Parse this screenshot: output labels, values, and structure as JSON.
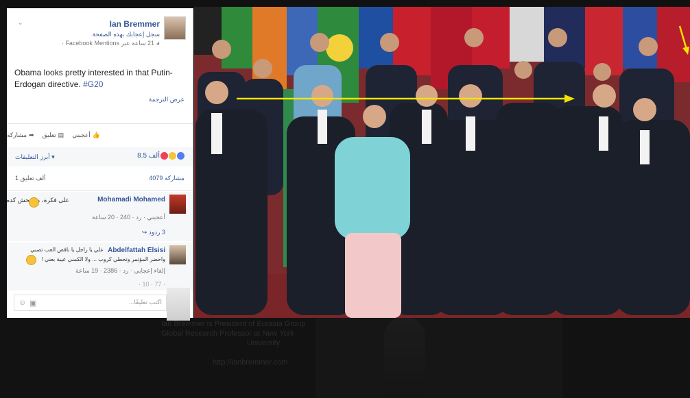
{
  "post_card": {
    "author": "Ian Bremmer",
    "subtitle_line1": "سجل إعجابك بهذه الصفحة",
    "subtitle_line2": "21 ساعة عبر Facebook Mentions · ",
    "text_main": "Obama looks pretty interested in that Putin-Erdogan directive. ",
    "hashtag": "#G20",
    "translate_link": "عرض الترجمة",
    "actions": {
      "like": "أعجبني",
      "comment": "تعليق",
      "share": "مشاركة"
    },
    "top_comments": "أبرز التعليقات ▾",
    "reactions_count": "8.5 ألف",
    "shares": "4079 مشاركة",
    "comments_count": "1 ألف تعليق",
    "comments": [
      {
        "name": "Mohamadi Mohamed",
        "text": "على فكرة، ميصحش كده",
        "meta": "أعجبني · رد · 240 · 20 ساعة",
        "replies": "3 ردود"
      },
      {
        "name": "Abdelfattah Elsisi",
        "text_line1": "علي يا راجل يا ناقص العب تصبي",
        "text_line2": "واحضر المؤتمر وتحطي كروب ... ولا الكمني عيبة بعني !",
        "meta": "إلغاء إعجابي · رد · 2386 · 19 ساعة",
        "cut_line": "· 77 · 10 ·"
      }
    ],
    "comment_placeholder": "اكتب تعليقًا..."
  },
  "background_text": {
    "line1": "Ian Bremmer is President of Eurasia Group",
    "line2": "Global Research Professor at New York",
    "line3": "University",
    "url": "http://ianbremmer.com"
  },
  "colors": {
    "link": "#365899",
    "photo_backdrop": "#7a2f2e",
    "annotation_arrow": "#f2e300"
  }
}
